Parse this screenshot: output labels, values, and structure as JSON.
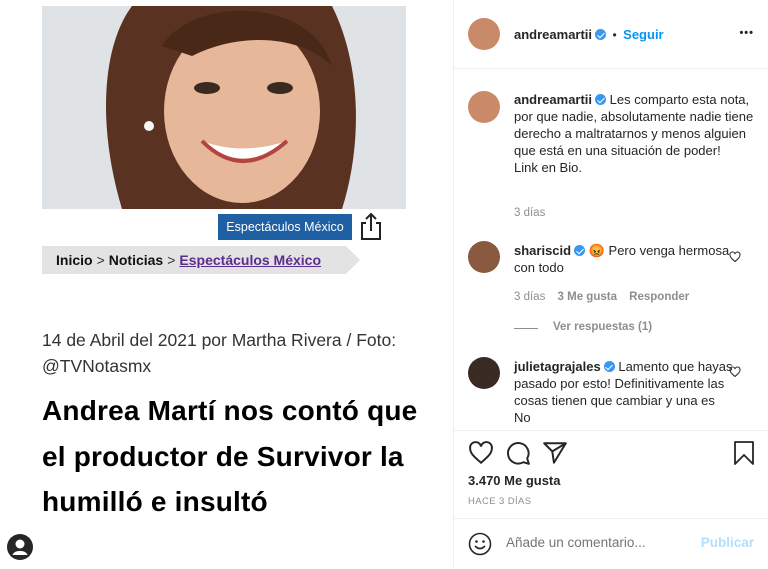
{
  "post": {
    "tag_label": "Espectáculos México",
    "breadcrumb": {
      "home": "Inicio",
      "sep": ">",
      "news": "Noticias",
      "section": "Espectáculos México"
    },
    "date_line": "14 de Abril del 2021 por Martha Rivera / Foto: @TVNotasmx",
    "headline": "Andrea Martí nos contó que el productor de Survivor la humilló e insultó"
  },
  "header": {
    "username": "andreamartii",
    "dot": "•",
    "follow_label": "Seguir",
    "more_label": "•••"
  },
  "caption": {
    "username": "andreamartii",
    "text": "Les comparto esta nota, por que nadie, absolutamente nadie tiene derecho a maltratarnos y menos alguien que está en una situación de poder!",
    "text2": "Link en Bio.",
    "time": "3 días"
  },
  "comments": [
    {
      "username": "shariscid",
      "emoji": "😡",
      "text": "Pero venga hermosa con todo",
      "time": "3 días",
      "likes": "3 Me gusta",
      "reply": "Responder",
      "view_replies": "Ver respuestas (1)"
    },
    {
      "username": "julietagrajales",
      "text": "Lamento que hayas pasado por esto! Definitivamente las cosas tienen que cambiar y una es No"
    }
  ],
  "stats": {
    "likes": "3.470 Me gusta",
    "ago": "HACE 3 DÍAS"
  },
  "add_comment": {
    "placeholder": "Añade un comentario...",
    "publish_label": "Publicar"
  },
  "colors": {
    "accent": "#0095f6",
    "tag_bg": "#1f5fa3",
    "verified": "#3897f0"
  }
}
